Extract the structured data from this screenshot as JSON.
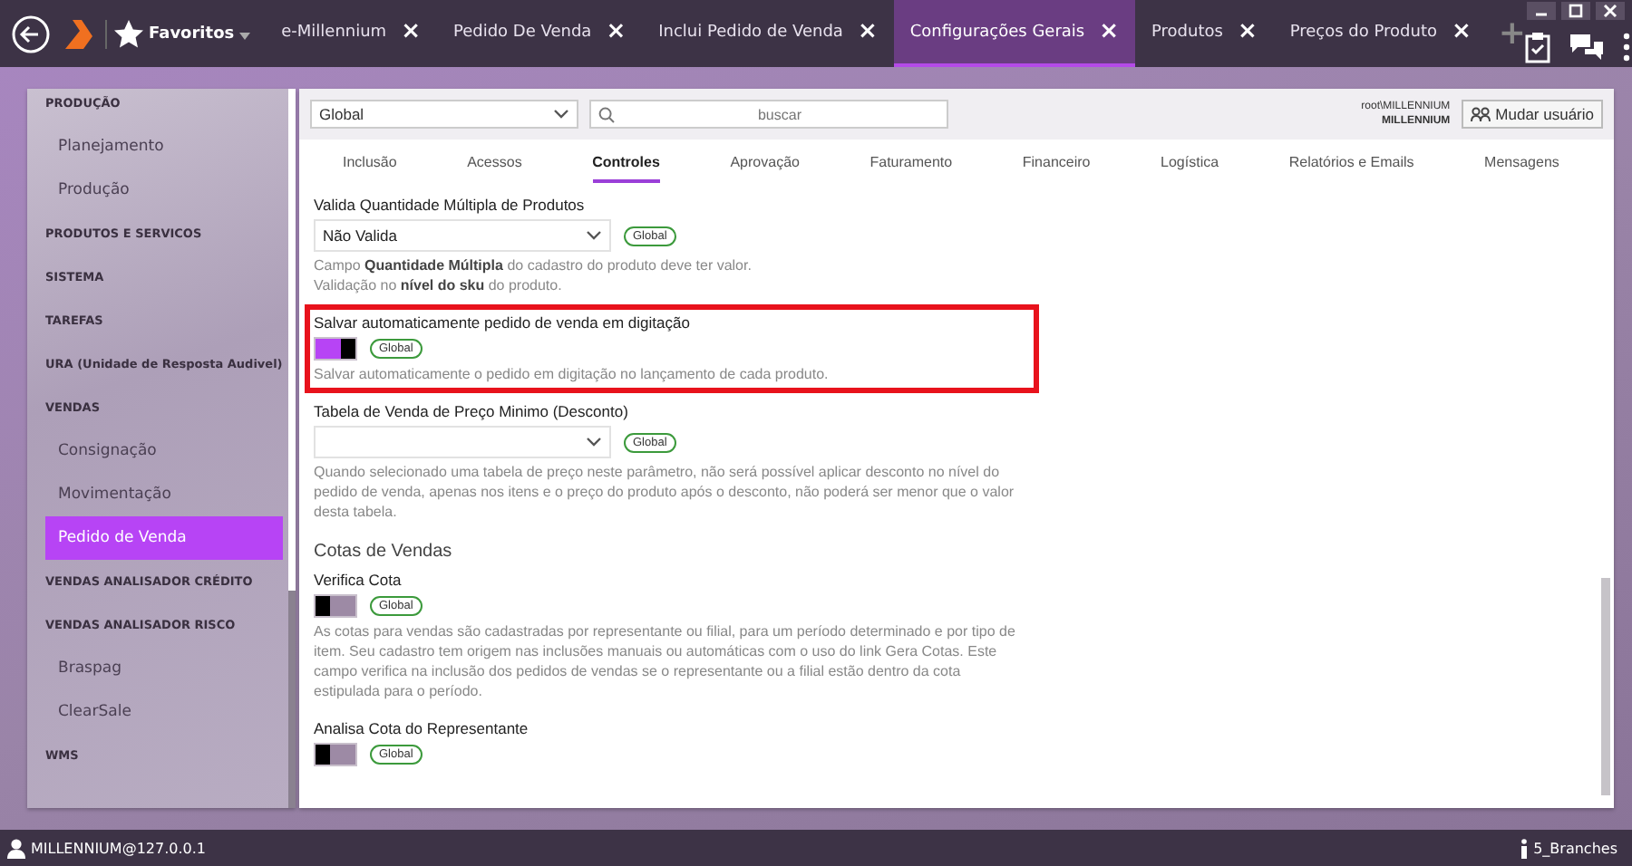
{
  "topbar": {
    "favorites": "Favoritos",
    "tabs": [
      {
        "label": "e-Millennium",
        "selected": false
      },
      {
        "label": "Pedido De Venda",
        "selected": false
      },
      {
        "label": "Inclui Pedido de Venda",
        "selected": false
      },
      {
        "label": "Configurações Gerais",
        "selected": true
      },
      {
        "label": "Produtos",
        "selected": false
      },
      {
        "label": "Preços do Produto",
        "selected": false
      }
    ],
    "close_glyph": "×",
    "add_glyph": "+"
  },
  "sidebar": {
    "items": [
      {
        "kind": "group",
        "label": "PRODUÇÃO"
      },
      {
        "kind": "item",
        "label": "Planejamento",
        "selected": false
      },
      {
        "kind": "item",
        "label": "Produção",
        "selected": false
      },
      {
        "kind": "group",
        "label": "PRODUTOS E SERVICOS"
      },
      {
        "kind": "group",
        "label": "SISTEMA"
      },
      {
        "kind": "group",
        "label": "TAREFAS"
      },
      {
        "kind": "group",
        "label": "URA (Unidade de Resposta Audivel)"
      },
      {
        "kind": "group",
        "label": "VENDAS"
      },
      {
        "kind": "item",
        "label": "Consignação",
        "selected": false
      },
      {
        "kind": "item",
        "label": "Movimentação",
        "selected": false
      },
      {
        "kind": "item",
        "label": "Pedido de Venda",
        "selected": true
      },
      {
        "kind": "group",
        "label": "VENDAS ANALISADOR CRÉDITO"
      },
      {
        "kind": "group",
        "label": "VENDAS ANALISADOR RISCO"
      },
      {
        "kind": "item",
        "label": "Braspag",
        "selected": false
      },
      {
        "kind": "item",
        "label": "ClearSale",
        "selected": false
      },
      {
        "kind": "group",
        "label": "WMS"
      }
    ]
  },
  "toolbar": {
    "scope": "Global",
    "search_placeholder": "buscar",
    "user_line1": "root\\MILLENNIUM",
    "user_line2": "MILLENNIUM",
    "change_user": "Mudar usuário"
  },
  "tabs": [
    {
      "label": "Inclusão",
      "selected": false
    },
    {
      "label": "Acessos",
      "selected": false
    },
    {
      "label": "Controles",
      "selected": true
    },
    {
      "label": "Aprovação",
      "selected": false
    },
    {
      "label": "Faturamento",
      "selected": false
    },
    {
      "label": "Financeiro",
      "selected": false
    },
    {
      "label": "Logística",
      "selected": false
    },
    {
      "label": "Relatórios e Emails",
      "selected": false
    },
    {
      "label": "Mensagens",
      "selected": false
    }
  ],
  "settings": [
    {
      "kind": "select",
      "label": "Valida Quantidade Múltipla de Produtos",
      "value": "Não Valida",
      "badge": "Global",
      "highlighted": false,
      "description": "Campo **Quantidade Múltipla** do cadastro do produto deve ter valor.\nValidação no **nível do sku** do produto."
    },
    {
      "kind": "toggle",
      "label": "Salvar automaticamente pedido de venda em digitação",
      "on": true,
      "badge": "Global",
      "highlighted": true,
      "description": "Salvar automaticamente o pedido em digitação no lançamento de cada produto."
    },
    {
      "kind": "select",
      "label": "Tabela de Venda de Preço Minimo (Desconto)",
      "badge": "Global",
      "highlighted": false,
      "description": "Quando selecionado uma tabela de preço neste parâmetro, não será possível aplicar desconto no nível do pedido de venda, apenas nos itens e o preço do produto após o desconto, não poderá ser menor que o valor desta tabela."
    },
    {
      "kind": "heading",
      "label": "Cotas de Vendas"
    },
    {
      "kind": "toggle",
      "label": "Verifica Cota",
      "on": false,
      "badge": "Global",
      "highlighted": false,
      "description": "As cotas para vendas são cadastradas por representante ou filial, para um período determinado e por tipo de item. Seu cadastro tem origem nas inclusões manuais ou automáticas com o uso do link Gera Cotas. Este campo verifica na inclusão dos pedidos de vendas se o representante ou a filial estão dentro da cota estipulada para o período."
    },
    {
      "kind": "toggle",
      "label": "Analisa Cota do Representante",
      "on": false,
      "badge": "Global",
      "highlighted": false
    }
  ],
  "status_bar": {
    "connection": "MILLENNIUM@127.0.0.1",
    "branches": "5_Branches"
  }
}
